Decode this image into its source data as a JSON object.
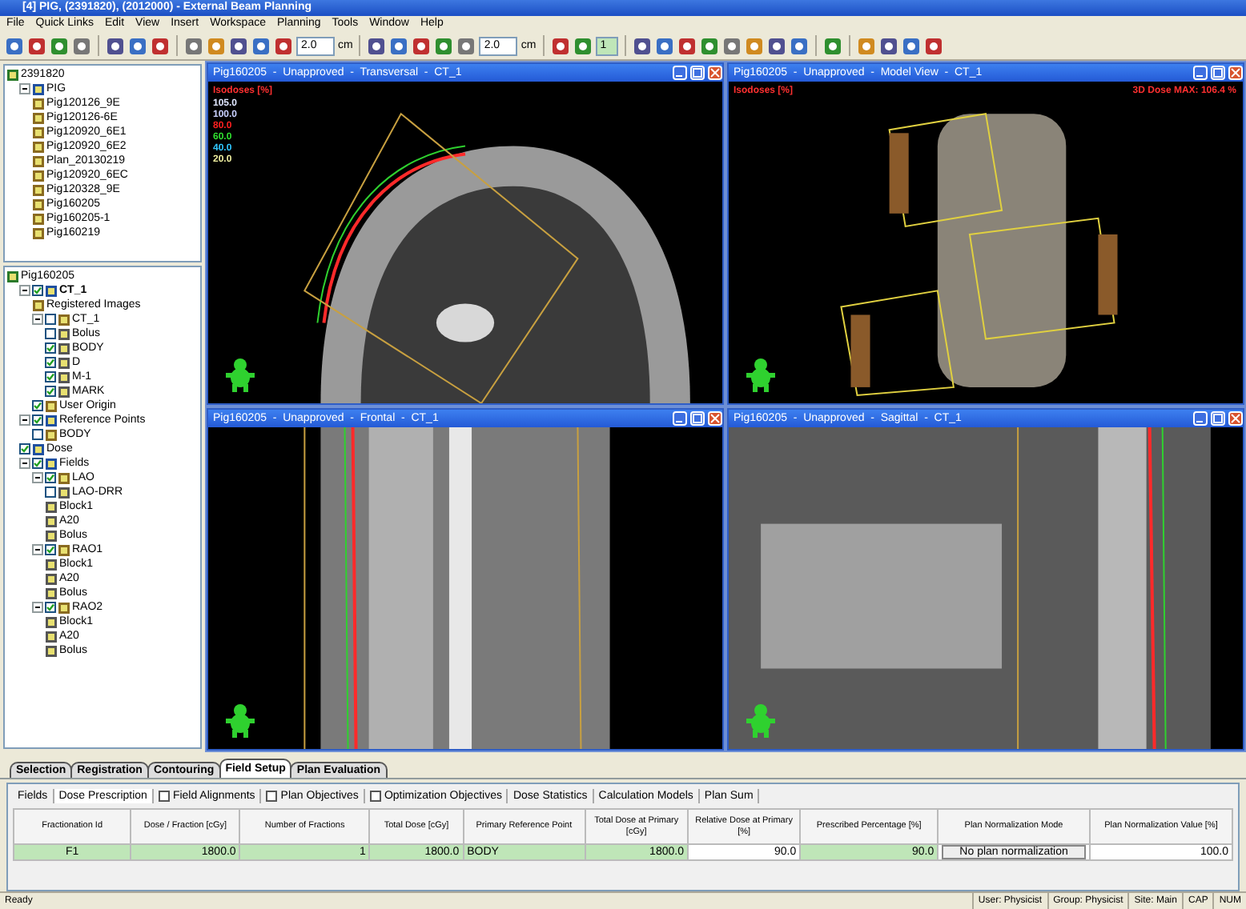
{
  "window": {
    "title": "[4] PIG,  (2391820), (2012000) - External Beam Planning"
  },
  "menu": [
    "File",
    "Quick Links",
    "Edit",
    "View",
    "Insert",
    "Workspace",
    "Planning",
    "Tools",
    "Window",
    "Help"
  ],
  "toolbar": [
    {
      "kind": "icon"
    },
    {
      "kind": "icon"
    },
    {
      "kind": "icon"
    },
    {
      "kind": "icon"
    },
    {
      "kind": "separator"
    },
    {
      "kind": "icon"
    },
    {
      "kind": "icon"
    },
    {
      "kind": "icon"
    },
    {
      "kind": "separator"
    },
    {
      "kind": "icon"
    },
    {
      "kind": "icon"
    },
    {
      "kind": "icon"
    },
    {
      "kind": "icon"
    },
    {
      "kind": "icon"
    },
    {
      "kind": "field",
      "value": "2.0",
      "highlighted": false
    },
    {
      "kind": "unit",
      "text": "cm"
    },
    {
      "kind": "separator"
    },
    {
      "kind": "icon"
    },
    {
      "kind": "icon"
    },
    {
      "kind": "icon"
    },
    {
      "kind": "icon"
    },
    {
      "kind": "icon"
    },
    {
      "kind": "field",
      "value": "2.0",
      "highlighted": false
    },
    {
      "kind": "unit",
      "text": "cm"
    },
    {
      "kind": "separator"
    },
    {
      "kind": "icon"
    },
    {
      "kind": "icon"
    },
    {
      "kind": "field",
      "value": "1",
      "highlighted": true
    },
    {
      "kind": "separator"
    },
    {
      "kind": "icon"
    },
    {
      "kind": "icon"
    },
    {
      "kind": "icon"
    },
    {
      "kind": "icon"
    },
    {
      "kind": "icon"
    },
    {
      "kind": "icon"
    },
    {
      "kind": "icon"
    },
    {
      "kind": "icon"
    },
    {
      "kind": "separator"
    },
    {
      "kind": "icon"
    },
    {
      "kind": "separator"
    },
    {
      "kind": "icon"
    },
    {
      "kind": "icon"
    },
    {
      "kind": "icon"
    },
    {
      "kind": "icon"
    }
  ],
  "patient_tree": {
    "label": "2391820",
    "children": [
      {
        "label": "PIG",
        "expanded": true,
        "children": [
          {
            "label": "Pig120126_9E"
          },
          {
            "label": "Pig120126-6E"
          },
          {
            "label": "Pig120920_6E1"
          },
          {
            "label": "Pig120920_6E2"
          },
          {
            "label": "Plan_20130219"
          },
          {
            "label": "Pig120920_6EC"
          },
          {
            "label": "Pig120328_9E"
          },
          {
            "label": "Pig160205"
          },
          {
            "label": "Pig160205-1"
          },
          {
            "label": "Pig160219"
          }
        ]
      }
    ]
  },
  "plan_tree": {
    "label": "Pig160205",
    "children": [
      {
        "label": "CT_1",
        "bold": true,
        "expanded": true,
        "checked": true,
        "children": [
          {
            "label": "Registered Images"
          },
          {
            "label": "CT_1",
            "expanded": true,
            "checked": false,
            "children": [
              {
                "label": "Bolus",
                "checked": false
              },
              {
                "label": "BODY",
                "checked": true
              },
              {
                "label": "D",
                "checked": true
              },
              {
                "label": "M-1",
                "checked": true
              },
              {
                "label": "MARK",
                "checked": true
              }
            ]
          },
          {
            "label": "User Origin",
            "checked": true
          }
        ]
      },
      {
        "label": "Reference Points",
        "expanded": true,
        "checked": true,
        "children": [
          {
            "label": "BODY",
            "checked": false
          }
        ]
      },
      {
        "label": "Dose",
        "checked": true
      },
      {
        "label": "Fields",
        "expanded": true,
        "checked": true,
        "children": [
          {
            "label": "LAO",
            "expanded": true,
            "checked": true,
            "children": [
              {
                "label": "LAO-DRR",
                "checked": false
              },
              {
                "label": "Block1"
              },
              {
                "label": "A20"
              },
              {
                "label": "Bolus"
              }
            ]
          },
          {
            "label": "RAO1",
            "expanded": true,
            "checked": true,
            "children": [
              {
                "label": "Block1"
              },
              {
                "label": "A20"
              },
              {
                "label": "Bolus"
              }
            ]
          },
          {
            "label": "RAO2",
            "expanded": true,
            "checked": true,
            "children": [
              {
                "label": "Block1"
              },
              {
                "label": "A20"
              },
              {
                "label": "Bolus"
              }
            ]
          }
        ]
      }
    ]
  },
  "views": [
    {
      "kind": "transversal",
      "title": "Pig160205  -  Unapproved  -  Transversal  -  CT_1",
      "legend_title": "Isodoses [%]",
      "legend": [
        {
          "text": "105.0",
          "color": "#dfe6ff"
        },
        {
          "text": "100.0",
          "color": "#c8d0ff"
        },
        {
          "text": "80.0",
          "color": "#ff2020"
        },
        {
          "text": "60.0",
          "color": "#30e030"
        },
        {
          "text": "40.0",
          "color": "#30c8ff"
        },
        {
          "text": "20.0",
          "color": "#f0f0a0"
        }
      ]
    },
    {
      "kind": "model",
      "title": "Pig160205  -  Unapproved  -  Model View  -  CT_1",
      "legend_title": "Isodoses [%]",
      "dose_max": "3D Dose MAX: 106.4 %"
    },
    {
      "kind": "frontal",
      "title": "Pig160205  -  Unapproved  -  Frontal  -  CT_1"
    },
    {
      "kind": "sagittal",
      "title": "Pig160205  -  Unapproved  -  Sagittal  -  CT_1"
    }
  ],
  "workspace_tabs": [
    {
      "label": "Selection",
      "selected": false
    },
    {
      "label": "Registration",
      "selected": false
    },
    {
      "label": "Contouring",
      "selected": false
    },
    {
      "label": "Field Setup",
      "selected": true
    },
    {
      "label": "Plan Evaluation",
      "selected": false
    }
  ],
  "panel_tabs": [
    {
      "label": "Fields",
      "kind": "tab",
      "selected": false
    },
    {
      "label": "Dose Prescription",
      "kind": "tab",
      "selected": true
    },
    {
      "label": "Field Alignments",
      "kind": "checkbox",
      "checked": false
    },
    {
      "label": "Plan Objectives",
      "kind": "checkbox",
      "checked": false
    },
    {
      "label": "Optimization Objectives",
      "kind": "checkbox",
      "checked": false
    },
    {
      "label": "Dose Statistics",
      "kind": "tab",
      "selected": false
    },
    {
      "label": "Calculation Models",
      "kind": "tab",
      "selected": false
    },
    {
      "label": "Plan Sum",
      "kind": "tab",
      "selected": false
    }
  ],
  "table": {
    "columns": [
      "Fractionation Id",
      "Dose / Fraction [cGy]",
      "Number of Fractions",
      "Total Dose [cGy]",
      "Primary Reference Point",
      "Total Dose at Primary [cGy]",
      "Relative Dose at Primary [%]",
      "Prescribed Percentage [%]",
      "Plan Normalization Mode",
      "Plan Normalization Value [%]"
    ],
    "rows": [
      [
        {
          "text": "F1",
          "kind": "center",
          "editable": true
        },
        {
          "text": "1800.0",
          "kind": "number",
          "editable": true
        },
        {
          "text": "1",
          "kind": "number",
          "editable": true
        },
        {
          "text": "1800.0",
          "kind": "number",
          "editable": true
        },
        {
          "text": "BODY",
          "kind": "text",
          "editable": true
        },
        {
          "text": "1800.0",
          "kind": "number",
          "editable": true
        },
        {
          "text": "90.0",
          "kind": "number",
          "editable": false
        },
        {
          "text": "90.0",
          "kind": "number",
          "editable": true
        },
        {
          "text": "No plan normalization",
          "kind": "button",
          "editable": false
        },
        {
          "text": "100.0",
          "kind": "number",
          "editable": false
        }
      ]
    ]
  },
  "status_bar": [
    "Ready",
    "User: Physicist",
    "Group: Physicist",
    "Site: Main",
    "CAP",
    "NUM"
  ]
}
